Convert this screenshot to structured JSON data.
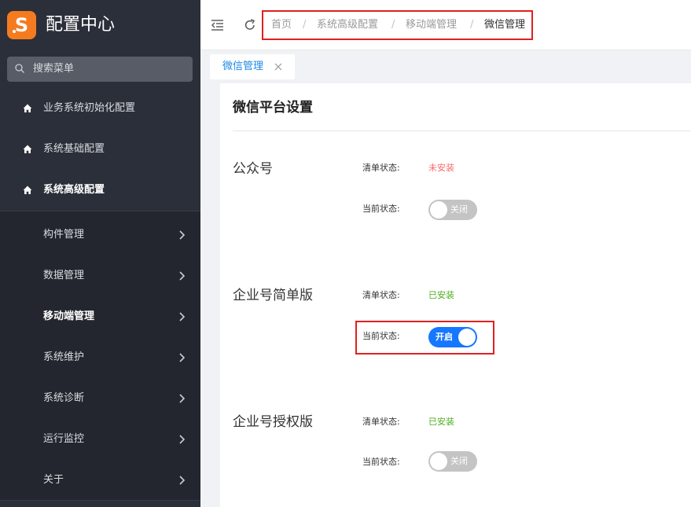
{
  "app": {
    "title": "配置中心",
    "logo_letter": "S"
  },
  "search": {
    "placeholder": "搜索菜单"
  },
  "sidebar": {
    "items": [
      {
        "label": "业务系统初始化配置"
      },
      {
        "label": "系统基础配置"
      },
      {
        "label": "系统高级配置"
      }
    ],
    "subitems": [
      {
        "label": "构件管理"
      },
      {
        "label": "数据管理"
      },
      {
        "label": "移动端管理"
      },
      {
        "label": "系统维护"
      },
      {
        "label": "系统诊断"
      },
      {
        "label": "运行监控"
      },
      {
        "label": "关于"
      }
    ]
  },
  "breadcrumb": {
    "items": [
      "首页",
      "系统高级配置",
      "移动端管理",
      "微信管理"
    ],
    "separator": "/"
  },
  "tabs": [
    {
      "label": "微信管理"
    }
  ],
  "panel": {
    "title": "微信平台设置",
    "list_status_label": "清单状态:",
    "current_status_label": "当前状态:",
    "sections": [
      {
        "name": "公众号",
        "list_status": "未安装",
        "switch_text": "关闭"
      },
      {
        "name": "企业号简单版",
        "list_status": "已安装",
        "switch_text": "开启"
      },
      {
        "name": "企业号授权版",
        "list_status": "已安装",
        "switch_text": "关闭"
      }
    ]
  },
  "colors": {
    "sidebar_bg": "#2b2f3a",
    "logo": "#f47b1f",
    "accent": "#1677ff",
    "status_not_installed": "#f56c6c",
    "status_installed": "#4caf1e",
    "highlight": "#e02020"
  }
}
